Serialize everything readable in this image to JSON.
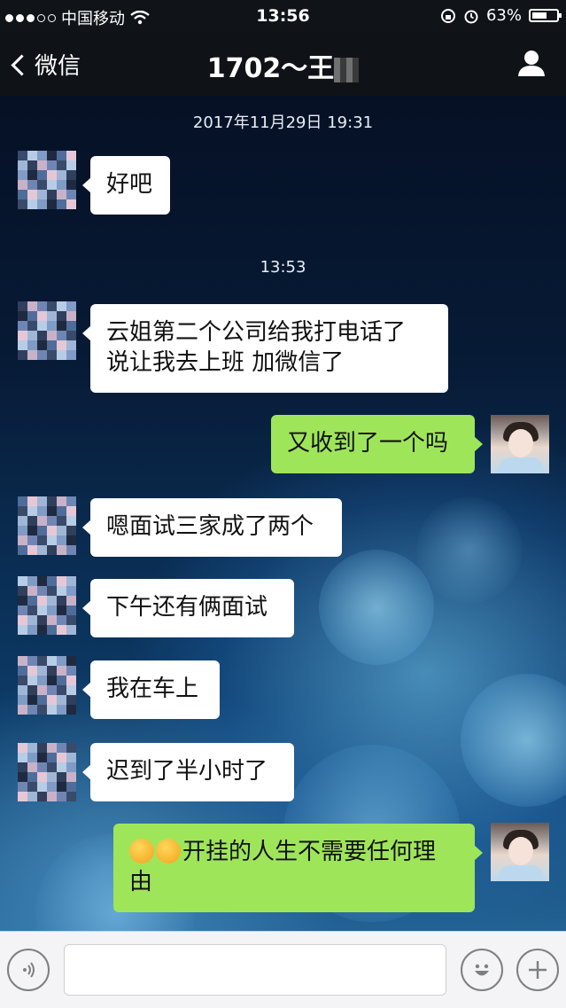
{
  "status_bar": {
    "carrier": "中国移动",
    "time": "13:56",
    "battery": "63%",
    "battery_level": 0.63
  },
  "nav": {
    "back_label": "微信",
    "title": "1702～王"
  },
  "chat": {
    "timestamps": [
      "2017年11月29日 19:31",
      "13:53"
    ],
    "messages": [
      {
        "side": "in",
        "text": "好吧"
      },
      {
        "side": "in",
        "text_lines": [
          "云姐第二个公司给我打电话了",
          "说让我去上班 加微信了"
        ]
      },
      {
        "side": "out",
        "text": "又收到了一个吗"
      },
      {
        "side": "in",
        "text": "嗯面试三家成了两个"
      },
      {
        "side": "in",
        "text": "下午还有俩面试"
      },
      {
        "side": "in",
        "text": "我在车上"
      },
      {
        "side": "in",
        "text": "迟到了半小时了"
      },
      {
        "side": "out",
        "text_lines": [
          "开挂的人生不需要任何理",
          "由"
        ],
        "emoji": "grinning-face-emoji"
      }
    ]
  },
  "input_bar": {
    "voice_icon": "voice-icon",
    "emoji_icon": "smiley-icon",
    "plus_icon": "plus-icon"
  },
  "colors": {
    "incoming_bubble": "#ffffff",
    "outgoing_bubble": "#9fe55a",
    "nav_background": "#0f1317"
  }
}
